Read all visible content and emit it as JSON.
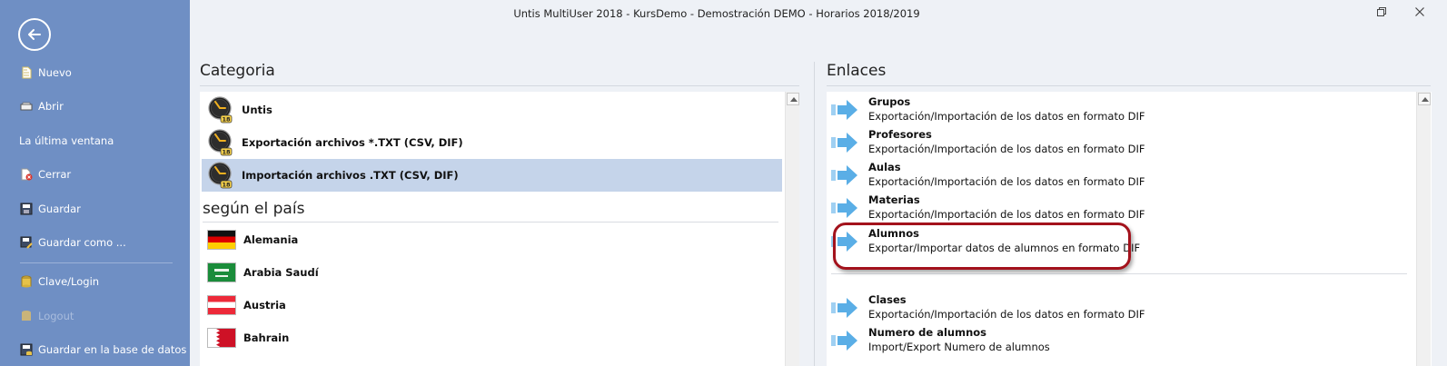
{
  "window": {
    "title": "Untis MultiUser 2018 - KursDemo  -  Demostración  DEMO  -  Horarios 2018/2019",
    "restore_icon": "restore-icon",
    "close_icon": "close-icon"
  },
  "sidebar": {
    "back_icon": "arrow-left-icon",
    "items": [
      {
        "label": "Nuevo",
        "icon": "new-file-icon"
      },
      {
        "label": "Abrir",
        "icon": "open-folder-icon"
      },
      {
        "label": "La última ventana",
        "icon": ""
      },
      {
        "label": "Cerrar",
        "icon": "close-file-icon"
      },
      {
        "label": "Guardar",
        "icon": "save-icon"
      },
      {
        "label": "Guardar como ...",
        "icon": "save-as-icon"
      },
      {
        "label": "Clave/Login",
        "icon": "key-icon"
      },
      {
        "label": "Logout",
        "icon": "logout-icon"
      },
      {
        "label": "Guardar en la base de datos",
        "icon": "database-icon"
      }
    ]
  },
  "categoria": {
    "title": "Categoria",
    "items": [
      {
        "label": "Untis",
        "icon": "untis-clock-icon",
        "selected": false
      },
      {
        "label": "Exportación archivos *.TXT (CSV, DIF)",
        "icon": "untis-clock-icon",
        "selected": false
      },
      {
        "label": "Importación archivos .TXT (CSV, DIF)",
        "icon": "untis-clock-icon",
        "selected": true
      }
    ],
    "clock_badge": "18",
    "pais_title": "según el país",
    "countries": [
      {
        "label": "Alemania",
        "icon": "flag-germany-icon"
      },
      {
        "label": "Arabia Saudí",
        "icon": "flag-saudi-arabia-icon"
      },
      {
        "label": "Austria",
        "icon": "flag-austria-icon"
      },
      {
        "label": "Bahrain",
        "icon": "flag-bahrain-icon"
      }
    ]
  },
  "enlaces": {
    "title": "Enlaces",
    "links": [
      {
        "title": "Grupos",
        "desc": "Exportación/Importación de los datos en formato DIF"
      },
      {
        "title": "Profesores",
        "desc": "Exportación/Importación de los datos en formato DIF"
      },
      {
        "title": "Aulas",
        "desc": "Exportación/Importación de los datos en formato DIF"
      },
      {
        "title": "Materias",
        "desc": "Exportación/Importación de los datos en formato DIF"
      },
      {
        "title": "Alumnos",
        "desc": "Exportar/Importar datos de alumnos en formato DIF"
      },
      {
        "title": "Clases",
        "desc": "Exportación/Importación de los datos en formato DIF"
      },
      {
        "title": "Numero de alumnos",
        "desc": "Import/Export Numero de alumnos"
      }
    ],
    "highlight_color": "#a3121c"
  },
  "colors": {
    "sidebar_bg": "#6f8fc4",
    "selected_row": "#c5d4ea",
    "arrow_blue": "#5aaee6"
  }
}
